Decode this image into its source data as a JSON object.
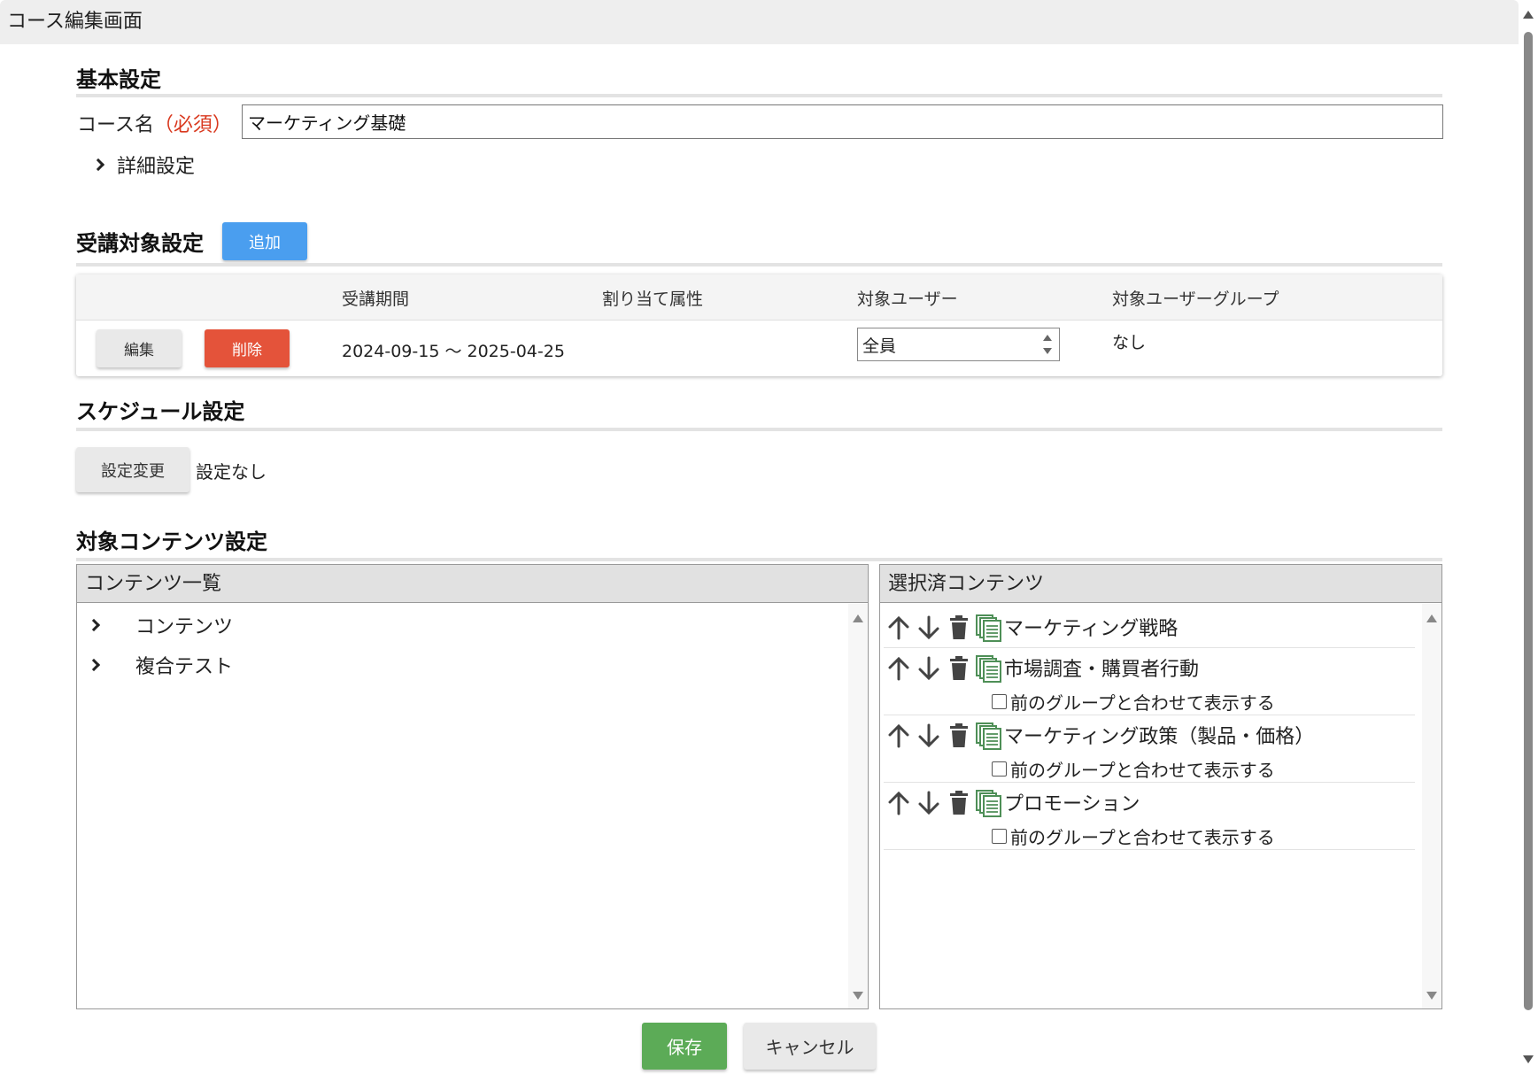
{
  "window": {
    "title": "コース編集画面"
  },
  "basic": {
    "heading": "基本設定",
    "course_name_label": "コース名",
    "required_label": "（必須）",
    "course_name_value": "マーケティング基礎",
    "detail_toggle": "詳細設定"
  },
  "target": {
    "heading": "受講対象設定",
    "add_button": "追加",
    "columns": [
      "受講期間",
      "割り当て属性",
      "対象ユーザー",
      "対象ユーザーグループ"
    ],
    "row": {
      "edit_button": "編集",
      "delete_button": "削除",
      "period": "2024-09-15 ～ 2025-04-25",
      "attribute": "",
      "user_select": "全員",
      "user_group": "なし"
    }
  },
  "schedule": {
    "heading": "スケジュール設定",
    "change_button": "設定変更",
    "status": "設定なし"
  },
  "contents": {
    "heading": "対象コンテンツ設定",
    "list_panel_title": "コンテンツ一覧",
    "list_items": [
      "コンテンツ",
      "複合テスト"
    ],
    "selected_panel_title": "選択済コンテンツ",
    "combine_option_label": "前のグループと合わせて表示する",
    "selected_items": [
      {
        "name": "マーケティング戦略",
        "has_option": false
      },
      {
        "name": "市場調査・購買者行動",
        "has_option": true
      },
      {
        "name": "マーケティング政策（製品・価格）",
        "has_option": true
      },
      {
        "name": "プロモーション",
        "has_option": true
      }
    ]
  },
  "footer": {
    "save_button": "保存",
    "cancel_button": "キャンセル"
  },
  "colors": {
    "primary": "#4a9eef",
    "danger": "#e4533a",
    "success": "#5cab57",
    "required": "#d9391f"
  },
  "icons": [
    "arrow-up-icon",
    "arrow-down-icon",
    "trash-icon",
    "content-stack-icon",
    "chevron-right-icon"
  ]
}
